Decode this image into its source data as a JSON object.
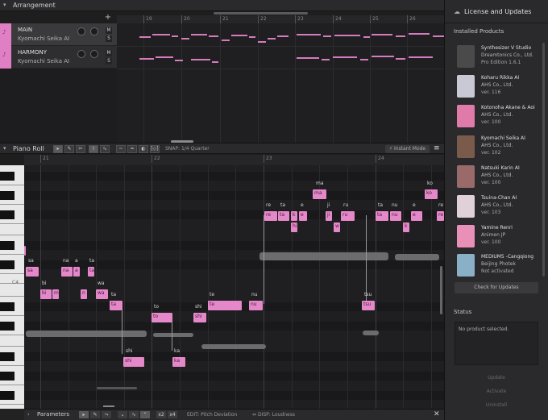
{
  "arrangement": {
    "title": "Arrangement",
    "ruler": [
      "19",
      "20",
      "21",
      "22",
      "23",
      "24",
      "25",
      "26"
    ],
    "add_track": "+",
    "tracks": [
      {
        "name": "MAIN",
        "singer": "Kyomachi Seika AI",
        "mute": "M",
        "solo": "S"
      },
      {
        "name": "HARMONY",
        "singer": "Kyomachi Seika AI",
        "mute": "M",
        "solo": "S"
      }
    ]
  },
  "piano_roll": {
    "title": "Piano Roll",
    "snap_label": "SNAP:",
    "snap_value": "1/4 Quarter",
    "instant_mode": "Instant Mode",
    "ruler": [
      "21",
      "22",
      "23",
      "24"
    ],
    "key_label": "C4",
    "notes": [
      {
        "lyric": "sa",
        "ph": "sa"
      },
      {
        "lyric": "bi",
        "ph": "bi"
      },
      {
        "lyric": "",
        "ph": "m"
      },
      {
        "lyric": "na",
        "ph": "na"
      },
      {
        "lyric": "a",
        "ph": "a"
      },
      {
        "lyric": "",
        "ph": "n"
      },
      {
        "lyric": "ta",
        "ph": "ta"
      },
      {
        "lyric": "wa",
        "ph": "wa"
      },
      {
        "lyric": "ta",
        "ph": "ta"
      },
      {
        "lyric": "shi",
        "ph": "shi"
      },
      {
        "lyric": "to",
        "ph": "to"
      },
      {
        "lyric": "ka",
        "ph": "ka"
      },
      {
        "lyric": "shi",
        "ph": "shi"
      },
      {
        "lyric": "te",
        "ph": "te"
      },
      {
        "lyric": "nu",
        "ph": "nu"
      },
      {
        "lyric": "re",
        "ph": "re"
      },
      {
        "lyric": "ta",
        "ph": "ta"
      },
      {
        "lyric": "",
        "ph": "k"
      },
      {
        "lyric": "e",
        "ph": "e"
      },
      {
        "lyric": "",
        "ph": "hi"
      },
      {
        "lyric": "ma",
        "ph": "ma"
      },
      {
        "lyric": "ji",
        "ph": "ji"
      },
      {
        "lyric": "",
        "ph": "w"
      },
      {
        "lyric": "ru",
        "ph": "ru"
      },
      {
        "lyric": "tsu",
        "ph": "tsu"
      },
      {
        "lyric": "ta",
        "ph": "ta"
      },
      {
        "lyric": "nu",
        "ph": "nu"
      },
      {
        "lyric": "e",
        "ph": "e"
      },
      {
        "lyric": "",
        "ph": "k"
      },
      {
        "lyric": "ko",
        "ph": "ko"
      },
      {
        "lyric": "re",
        "ph": "re"
      },
      {
        "lyric": "",
        "ph": "n"
      }
    ]
  },
  "parameters": {
    "title": "Parameters",
    "edit_label": "EDIT:",
    "edit_value": "Pitch Deviation",
    "disp_label": "DISP:",
    "disp_value": "Loudness",
    "tools": [
      "x2",
      "x4"
    ]
  },
  "right_panel": {
    "title": "License and Updates",
    "installed_title": "Installed Products",
    "products": [
      {
        "name": "Synthesizer V Studio",
        "company": "Dreamtonics Co., Ltd.",
        "version": "Pro Edition 1.6.1",
        "color": "#5a5a5a"
      },
      {
        "name": "Koharu Rikka AI",
        "company": "AHS Co., Ltd.",
        "version": "ver. 116",
        "color": "#c9c9d6"
      },
      {
        "name": "Kotonoha Akane & Aoi",
        "company": "AHS Co., Ltd.",
        "version": "ver. 100",
        "color": "#e07aa8"
      },
      {
        "name": "Kyomachi Seika AI",
        "company": "AHS Co., Ltd.",
        "version": "ver. 102",
        "color": "#7a5a4a"
      },
      {
        "name": "Natsuki Karin AI",
        "company": "AHS Co., Ltd.",
        "version": "ver. 100",
        "color": "#9a6a6a"
      },
      {
        "name": "Tsuina-Chan AI",
        "company": "AHS Co., Ltd.",
        "version": "ver. 103",
        "color": "#e0d0d8"
      },
      {
        "name": "Yamine Renri",
        "company": "Animen JP",
        "version": "ver. 100",
        "color": "#e890b8"
      },
      {
        "name": "MEDIUM5 -Cangqiong",
        "company": "Beijing Photek",
        "version": "Not activated",
        "color": "#8ab0c8"
      }
    ],
    "check_button": "Check for Updates",
    "status_title": "Status",
    "status_text": "No product selected.",
    "update_label": "Update",
    "activate_label": "Activate",
    "uninstall_label": "Uninstall"
  }
}
